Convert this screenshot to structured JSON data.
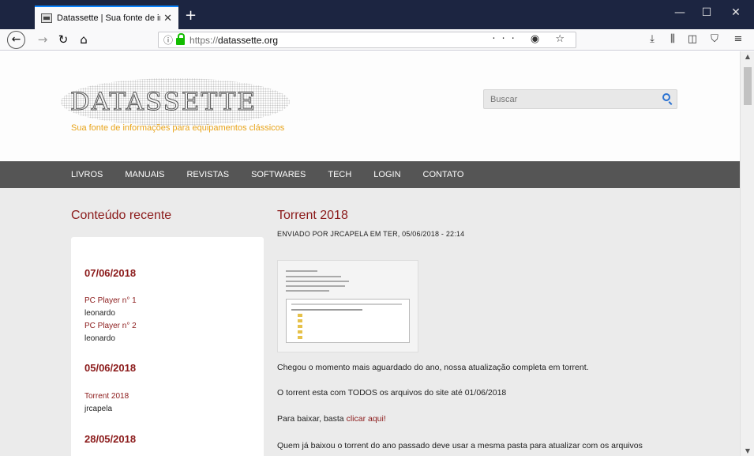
{
  "browser": {
    "tab_title": "Datassette | Sua fonte de informações",
    "tab_close": "✕",
    "new_tab": "+",
    "url_scheme": "https://",
    "url_host": "datassette.org",
    "url_actions": "··· ◉ ☆"
  },
  "site": {
    "logo": "DATASSETTE",
    "tagline": "Sua fonte de informações para equipamentos clássicos",
    "search_placeholder": "Buscar"
  },
  "menu": {
    "items": [
      "LIVROS",
      "MANUAIS",
      "REVISTAS",
      "SOFTWARES",
      "TECH",
      "LOGIN",
      "CONTATO"
    ]
  },
  "sidebar": {
    "heading": "Conteúdo recente",
    "groups": [
      {
        "date": "07/06/2018",
        "posts": [
          {
            "title": "PC Player n° 1",
            "author": "leonardo"
          },
          {
            "title": "PC Player n° 2",
            "author": "leonardo"
          }
        ]
      },
      {
        "date": "05/06/2018",
        "posts": [
          {
            "title": "Torrent 2018",
            "author": "jrcapela"
          }
        ]
      },
      {
        "date": "28/05/2018",
        "posts": []
      }
    ]
  },
  "article": {
    "title": "Torrent 2018",
    "byline": "ENVIADO POR JRCAPELA EM TER, 05/06/2018 - 22:14",
    "para1": "Chegou o momento mais aguardado do ano, nossa atualização completa em torrent.",
    "para2": "O torrent esta com TODOS os arquivos do site até 01/06/2018",
    "para3_prefix": "Para baixar, basta ",
    "para3_link": "clicar aqui!",
    "para4": "Quem já baixou o torrent do ano passado deve usar a mesma pasta para atualizar com os arquivos"
  },
  "colors": {
    "accent": "#8b1a1a",
    "menu_bg": "#555555",
    "tagline": "#e8a41a",
    "titlebar": "#1c2541"
  },
  "icons": [
    "back-arrow-icon",
    "forward-arrow-icon",
    "reload-icon",
    "home-icon",
    "info-icon",
    "lock-icon",
    "pocket-icon",
    "bookmark-star-icon",
    "download-icon",
    "library-icon",
    "sidebar-icon",
    "ublock-icon",
    "hamburger-menu-icon",
    "search-icon"
  ]
}
